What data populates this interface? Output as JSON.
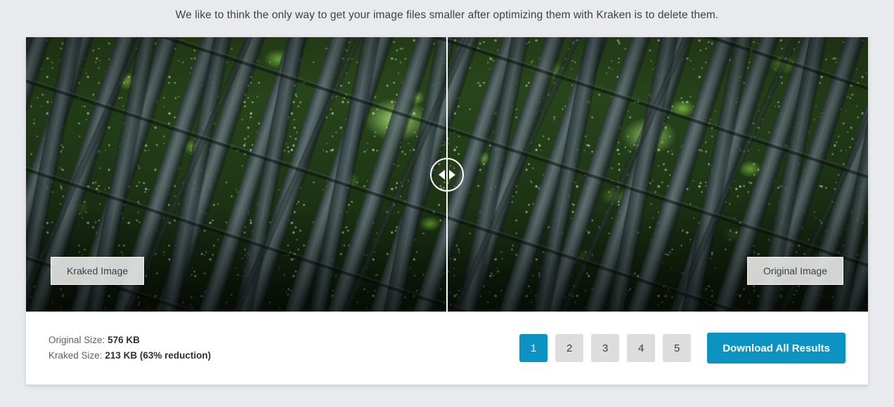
{
  "intro": {
    "heading": "",
    "subtitle": "We like to think the only way to get your image files smaller after optimizing them with Kraken is to delete them."
  },
  "viewer": {
    "left_label": "Kraked Image",
    "right_label": "Original Image",
    "divider_position_percent": 50,
    "handle_icon_left": "arrow-left-icon",
    "handle_icon_right": "arrow-right-icon",
    "image_subject": "bamboo forest photographed looking upward"
  },
  "stats": {
    "original_label": "Original Size:",
    "original_value": "576 KB",
    "kraked_label": "Kraked Size:",
    "kraked_value": "213 KB (63% reduction)"
  },
  "pagination": {
    "pages": [
      "1",
      "2",
      "3",
      "4",
      "5"
    ],
    "active_index": 0
  },
  "actions": {
    "download_all_label": "Download All Results"
  },
  "colors": {
    "accent": "#0d93c2",
    "page_background": "#e8eaee",
    "card_background": "#ffffff",
    "inactive_button": "#dddddd"
  }
}
